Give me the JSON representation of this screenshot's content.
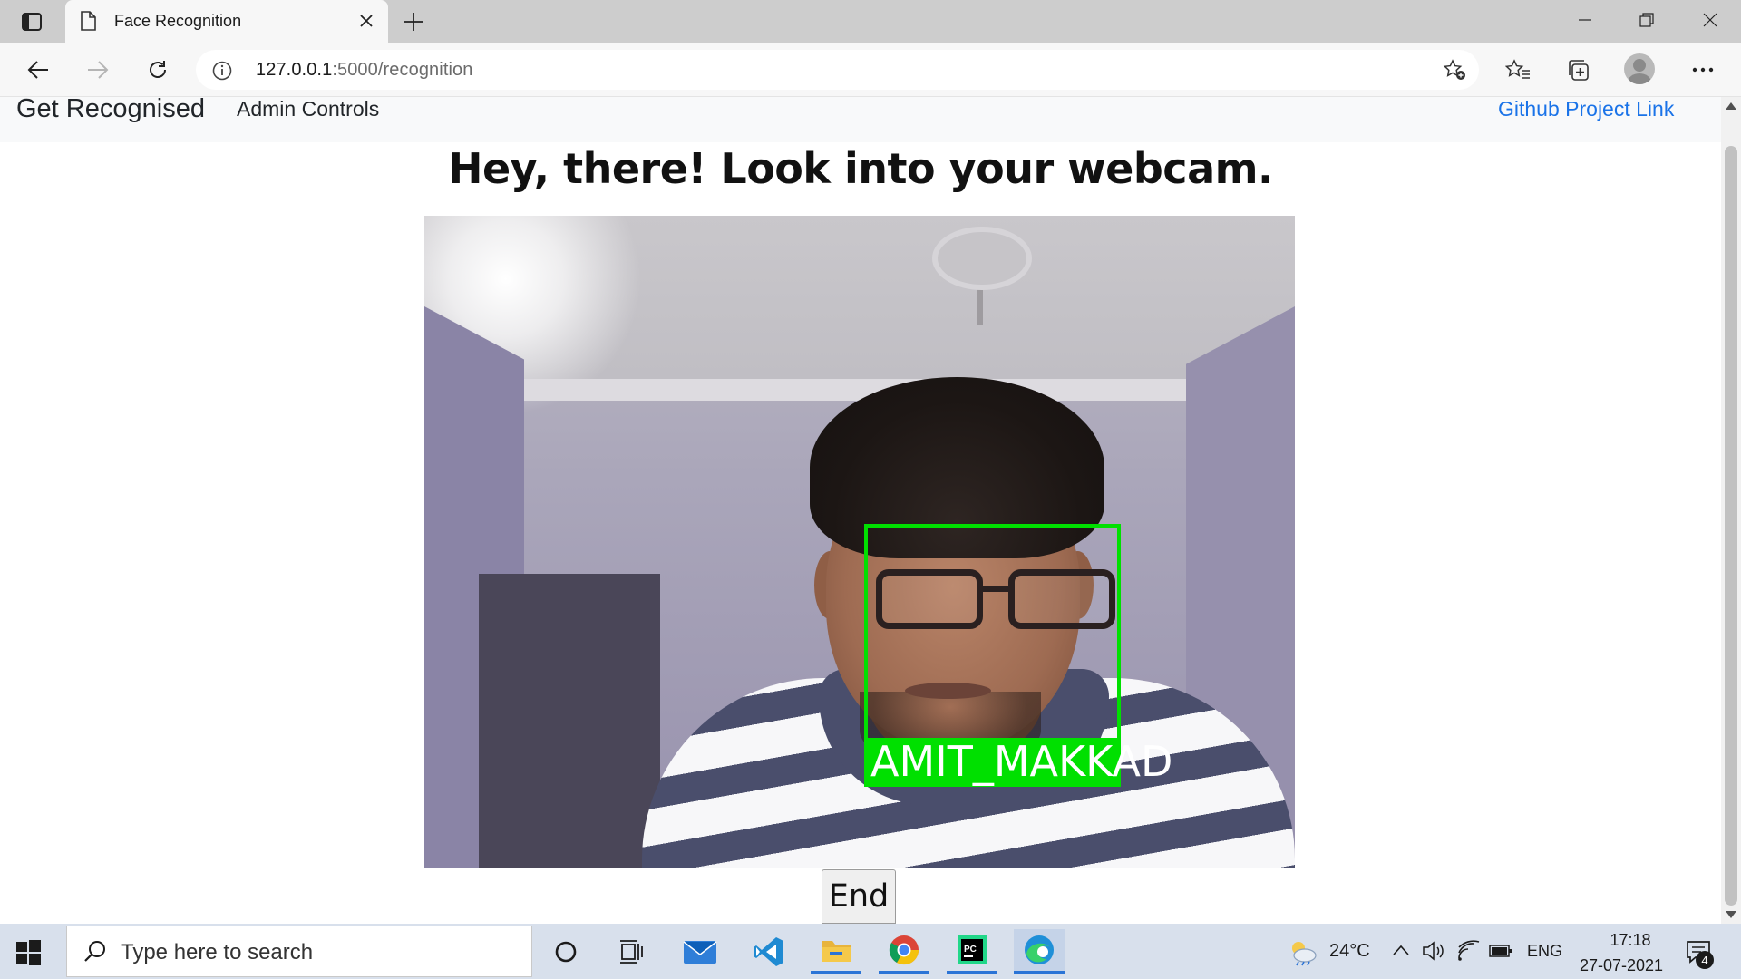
{
  "browser": {
    "tab_title": "Face Recognition",
    "url_host": "127.0.0.1",
    "url_path": ":5000/recognition"
  },
  "page": {
    "navbar": {
      "brand": "Get Recognised",
      "admin_link": "Admin Controls",
      "github_link": "Github Project Link"
    },
    "heading": "Hey, there! Look into your webcam.",
    "detection_label": "AMIT_MAKKAD",
    "end_button": "End"
  },
  "taskbar": {
    "search_placeholder": "Type here to search",
    "weather_temp": "24°C",
    "language": "ENG",
    "time": "17:18",
    "date": "27-07-2021",
    "notification_count": "4",
    "pinned": [
      "cortana-icon",
      "task-view-icon",
      "mail-icon",
      "vscode-icon",
      "file-explorer-icon",
      "chrome-icon",
      "pycharm-icon",
      "edge-icon"
    ]
  },
  "colors": {
    "link": "#1a73e8",
    "detection_box": "#00e000",
    "taskbar_active": "#2b74d6"
  }
}
